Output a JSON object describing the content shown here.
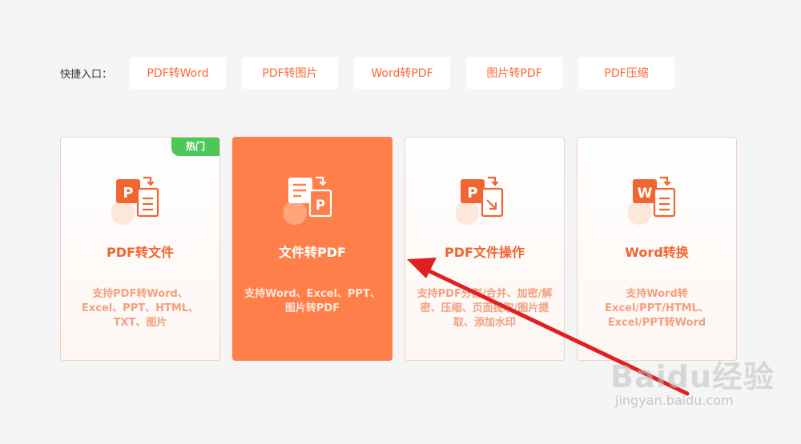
{
  "quick_entry": {
    "label": "快捷入口：",
    "buttons": [
      "PDF转Word",
      "PDF转图片",
      "Word转PDF",
      "图片转PDF",
      "PDF压缩"
    ]
  },
  "cards": [
    {
      "title": "PDF转文件",
      "desc": "支持PDF转Word、Excel、PPT、HTML、TXT、图片",
      "badge": "热门",
      "icon": "pdf-to-file-icon"
    },
    {
      "title": "文件转PDF",
      "desc": "支持Word、Excel、PPT、图片转PDF",
      "icon": "file-to-pdf-icon"
    },
    {
      "title": "PDF文件操作",
      "desc": "支持PDF分割/合并、加密/解密、压缩、页面提取/图片提取、添加水印",
      "icon": "pdf-operations-icon"
    },
    {
      "title": "Word转换",
      "desc": "支持Word转Excel/PPT/HTML、Excel/PPT转Word",
      "icon": "word-convert-icon"
    }
  ],
  "colors": {
    "accent": "#ff6633",
    "active_card": "#ff7f4a",
    "hot_badge": "#4cc75a",
    "annotation_arrow": "#e02020"
  },
  "watermark": {
    "logo": "Baidu经验",
    "url": "jingyan.baidu.com"
  }
}
